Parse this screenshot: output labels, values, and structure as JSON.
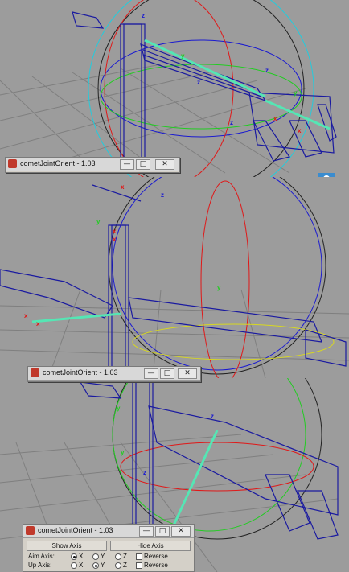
{
  "window": {
    "title": "cometJointOrient - 1.03",
    "min_symbol": "—",
    "max_symbol": "□",
    "close_symbol": "✕"
  },
  "tool_panel": {
    "show_axis_label": "Show Axis",
    "hide_axis_label": "Hide Axis",
    "aim_axis": {
      "label": "Aim Axis:",
      "options": [
        "X",
        "Y",
        "Z"
      ],
      "selected": "X",
      "reverse_label": "Reverse",
      "reverse_checked": false
    },
    "up_axis": {
      "label": "Up Axis:",
      "options": [
        "X",
        "Y",
        "Z"
      ],
      "selected": "Y",
      "reverse_label": "Reverse",
      "reverse_checked": false
    }
  },
  "colors": {
    "viewport_bg": "#9c9c9c",
    "grid": "#7f7f7f",
    "mesh": "#1a1aa0",
    "selected_bone": "#55e6b4",
    "axis_x": "#e01818",
    "axis_y": "#22cc22",
    "axis_z": "#1a1ad0",
    "manipulator_outer": "#22ccdd"
  }
}
